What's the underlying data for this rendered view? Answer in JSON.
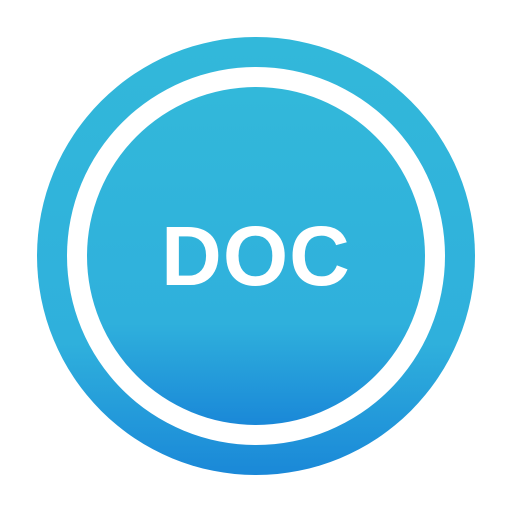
{
  "icon": {
    "label": "DOC",
    "name": "doc-file-icon",
    "colors": {
      "gradient_top": "#32b8da",
      "gradient_bottom": "#1a88d8",
      "ring_gap": "#ffffff",
      "text": "#ffffff"
    }
  }
}
